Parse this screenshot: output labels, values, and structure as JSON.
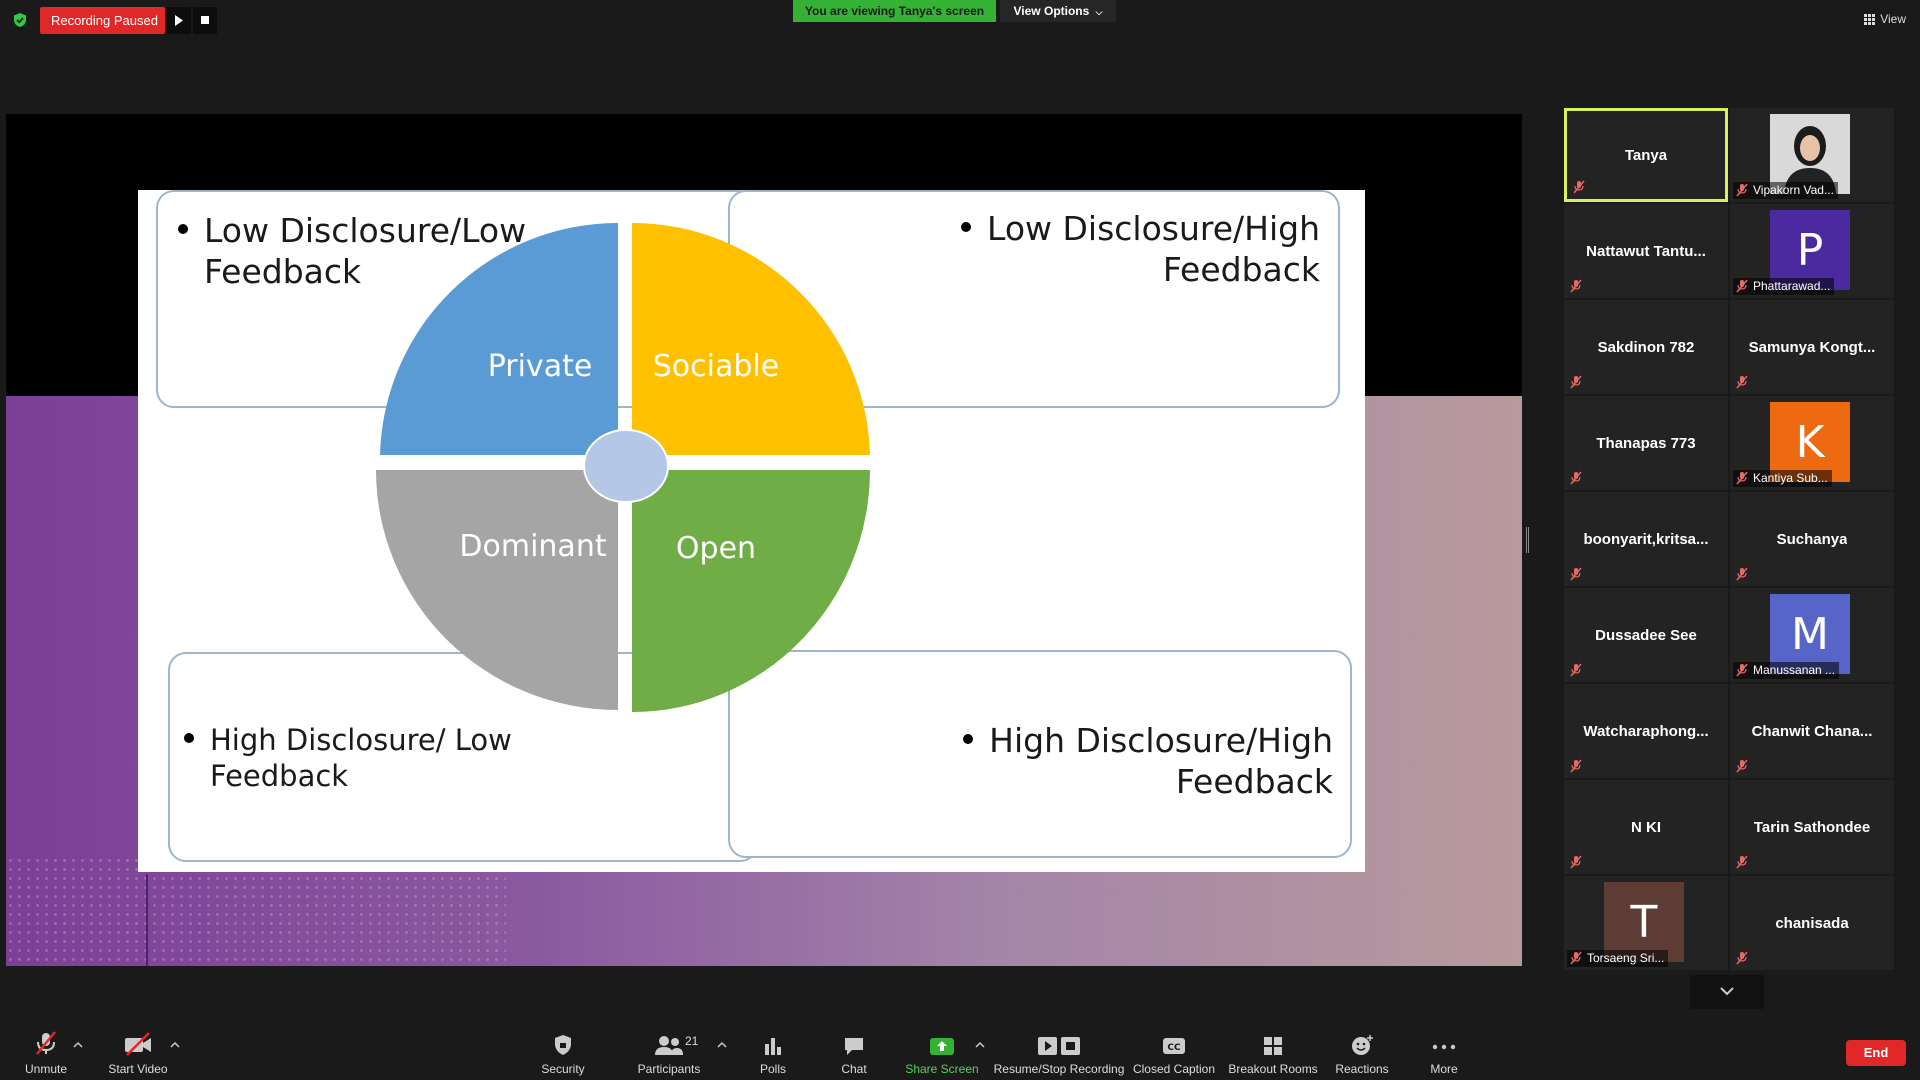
{
  "topbar": {
    "recording_label": "Recording Paused",
    "viewing_banner": "You are viewing Tanya's screen",
    "view_options": "View Options",
    "view_label": "View"
  },
  "slide": {
    "quadrants": {
      "top_left": {
        "line1": "Low Disclosure/Low",
        "line2": "Feedback"
      },
      "top_right": {
        "line1": "Low Disclosure/High",
        "line2": "Feedback"
      },
      "bottom_left": {
        "line1": "High Disclosure/ Low",
        "line2": "Feedback"
      },
      "bottom_right": {
        "line1": "High Disclosure/High",
        "line2": "Feedback"
      }
    },
    "wheel": {
      "private": "Private",
      "sociable": "Sociable",
      "dominant": "Dominant",
      "open": "Open",
      "colors": {
        "private": "#5b9bd5",
        "sociable": "#ffc000",
        "dominant": "#a5a5a5",
        "open": "#70ad47",
        "center": "#b4c7e7"
      }
    }
  },
  "participants": [
    {
      "name": "Tanya",
      "type": "name",
      "active": true
    },
    {
      "name": "Vipakorn Vad...",
      "type": "photo"
    },
    {
      "name": "Nattawut  Tantu...",
      "type": "name"
    },
    {
      "name": "Phattarawad...",
      "type": "avatar",
      "letter": "P",
      "color": "#4b2aa0"
    },
    {
      "name": "Sakdinon 782",
      "type": "name"
    },
    {
      "name": "Samunya  Kongt...",
      "type": "name"
    },
    {
      "name": "Thanapas 773",
      "type": "name"
    },
    {
      "name": "Kantiya Sub...",
      "type": "avatar",
      "letter": "K",
      "color": "#ee6a10"
    },
    {
      "name": "boonyarit,kritsa...",
      "type": "name"
    },
    {
      "name": "Suchanya",
      "type": "name"
    },
    {
      "name": "Dussadee See",
      "type": "name"
    },
    {
      "name": "Manussanan ...",
      "type": "avatar",
      "letter": "M",
      "color": "#5865c8"
    },
    {
      "name": "Watcharaphong...",
      "type": "name"
    },
    {
      "name": "Chanwit  Chana...",
      "type": "name"
    },
    {
      "name": "N KI",
      "type": "name"
    },
    {
      "name": "Tarin Sathondee",
      "type": "name"
    },
    {
      "name": "Torsaeng Sri...",
      "type": "avatar",
      "letter": "T",
      "color": "#5e3c36"
    },
    {
      "name": "chanisada",
      "type": "name"
    }
  ],
  "toolbar": {
    "unmute": "Unmute",
    "start_video": "Start Video",
    "security": "Security",
    "participants": "Participants",
    "participants_count": "21",
    "polls": "Polls",
    "chat": "Chat",
    "share_screen": "Share Screen",
    "resume_stop": "Resume/Stop Recording",
    "closed_caption": "Closed Caption",
    "breakout_rooms": "Breakout Rooms",
    "reactions": "Reactions",
    "more": "More",
    "end": "End"
  }
}
